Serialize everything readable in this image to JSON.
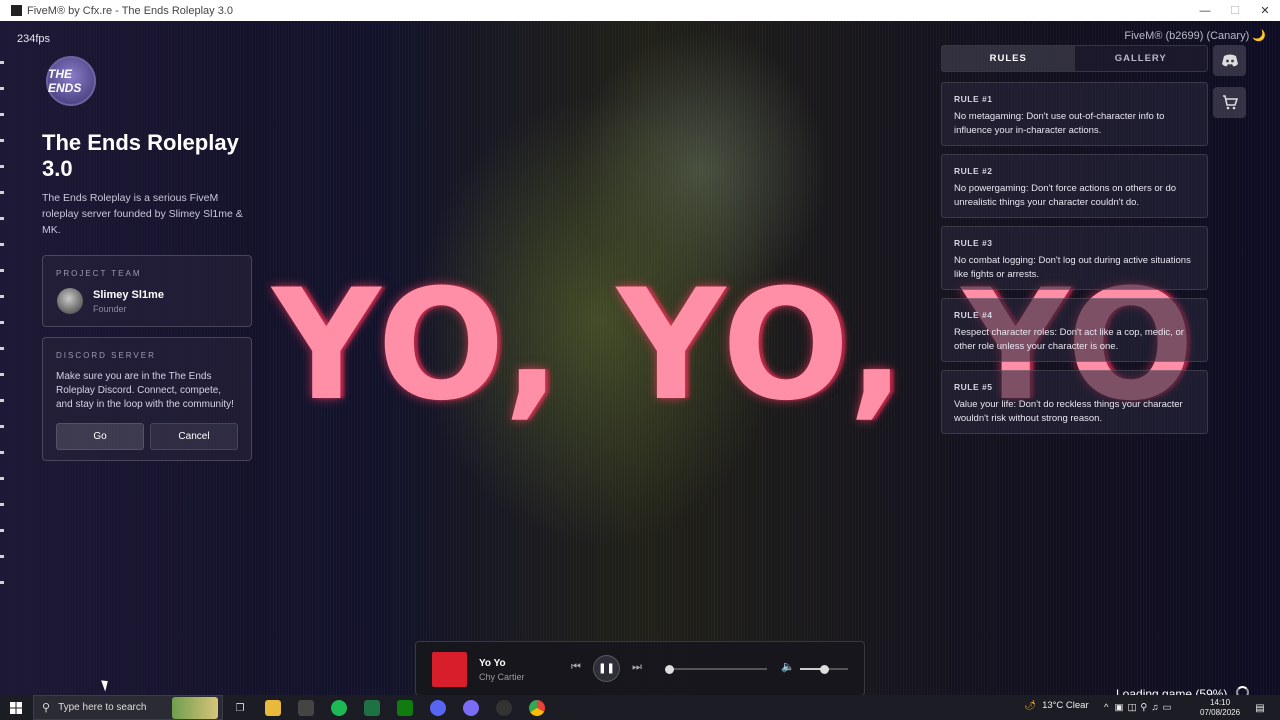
{
  "window": {
    "title": "FiveM® by Cfx.re - The Ends Roleplay 3.0",
    "minimize": "—",
    "maximize": "☐",
    "close": "✕"
  },
  "overlay": {
    "fps": "234fps",
    "version": "FiveM® (b2699) (Canary) 🌙",
    "video_text": "YO, YO, YO",
    "loading": "Loading game (59%)",
    "loading_progress": 0.59
  },
  "server": {
    "logo_text": "THE ENDS",
    "title": "The Ends Roleplay 3.0",
    "description": "The Ends Roleplay is a serious FiveM roleplay server founded by Slimey Sl1me & MK."
  },
  "team": {
    "caption": "PROJECT TEAM",
    "members": [
      {
        "name": "Slimey Sl1me",
        "role": "Founder"
      }
    ]
  },
  "discord": {
    "caption": "DISCORD SERVER",
    "message": "Make sure you are in the The Ends Roleplay Discord. Connect, compete, and stay in the loop with the community!",
    "go_label": "Go",
    "cancel_label": "Cancel"
  },
  "tabs": [
    {
      "label": "RULES",
      "active": true
    },
    {
      "label": "GALLERY",
      "active": false
    }
  ],
  "side_buttons": {
    "discord_icon": "discord-icon",
    "cart_icon": "cart-icon"
  },
  "rules": [
    {
      "title": "RULE #1",
      "text": "No metagaming: Don't use out-of-character info to influence your in-character actions."
    },
    {
      "title": "RULE #2",
      "text": "No powergaming: Don't force actions on others or do unrealistic things your character couldn't do."
    },
    {
      "title": "RULE #3",
      "text": "No combat logging: Don't log out during active situations like fights or arrests."
    },
    {
      "title": "RULE #4",
      "text": "Respect character roles: Don't act like a cop, medic, or other role unless your character is one."
    },
    {
      "title": "RULE #5",
      "text": "Value your life: Don't do reckless things your character wouldn't risk without strong reason."
    }
  ],
  "player": {
    "song": "Yo Yo",
    "artist": "Chy Cartier",
    "progress": 0.0,
    "volume": 0.5
  },
  "taskbar": {
    "search_placeholder": "Type here to search",
    "weather": "13°C  Clear",
    "time": "14:10",
    "date": "07/08/2026"
  },
  "colors": {
    "accent_text": "#ff8fa6",
    "album": "#d81e2b"
  }
}
